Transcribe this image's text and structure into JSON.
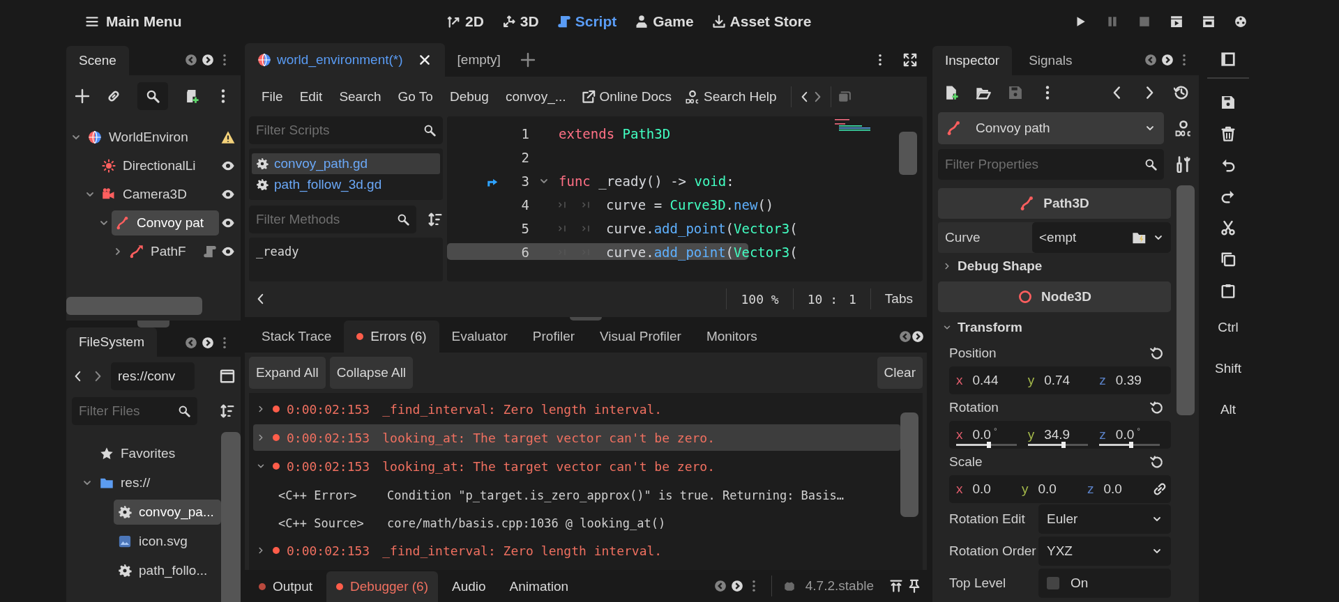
{
  "main_menu": "Main Menu",
  "workspaces": [
    {
      "label": "2D",
      "selected": false
    },
    {
      "label": "3D",
      "selected": false
    },
    {
      "label": "Script",
      "selected": true
    },
    {
      "label": "Game",
      "selected": false
    },
    {
      "label": "Asset Store",
      "selected": false
    }
  ],
  "scene_dock": {
    "tabs": [
      {
        "label": "Scene",
        "selected": true
      }
    ],
    "tree": [
      {
        "label": "WorldEnviron",
        "kind": "world_environment",
        "expanded": true,
        "selected": false,
        "warning": true,
        "children": [
          {
            "label": "DirectionalLi",
            "kind": "directional_light",
            "selected": false,
            "visible": true
          },
          {
            "label": "Camera3D",
            "kind": "camera",
            "expanded": true,
            "selected": false,
            "visible": true,
            "children": [
              {
                "label": "Convoy pat",
                "kind": "path",
                "expanded": true,
                "selected": true,
                "visible": true,
                "children": [
                  {
                    "label": "PathF",
                    "kind": "path_follow",
                    "expanded": false,
                    "selected": false,
                    "script": true,
                    "visible": true
                  }
                ]
              }
            ]
          }
        ]
      }
    ]
  },
  "filesystem_dock": {
    "tabs": [
      {
        "label": "FileSystem",
        "selected": true
      }
    ],
    "path": "res://conv",
    "filter_placeholder": "Filter Files",
    "tree": [
      {
        "label": "Favorites",
        "kind": "favorites",
        "selected": false
      },
      {
        "label": "res://",
        "kind": "folder",
        "expanded": true,
        "selected": false,
        "children": [
          {
            "label": "convoy_pa...",
            "kind": "script",
            "selected": true
          },
          {
            "label": "icon.svg",
            "kind": "image",
            "selected": false
          },
          {
            "label": "path_follo...",
            "kind": "script",
            "selected": false
          }
        ]
      }
    ]
  },
  "script_editor": {
    "tabs": [
      {
        "label": "world_environment(*)",
        "selected": true
      },
      {
        "label": "[empty]",
        "selected": false
      }
    ],
    "menu": [
      "File",
      "Edit",
      "Search",
      "Go To",
      "Debug",
      "convoy_..."
    ],
    "links": [
      "Online Docs",
      "Search Help"
    ],
    "filter_scripts_placeholder": "Filter Scripts",
    "scripts": [
      {
        "label": "convoy_path.gd",
        "selected": true
      },
      {
        "label": "path_follow_3d.gd",
        "selected": false
      }
    ],
    "filter_methods_placeholder": "Filter Methods",
    "methods": [
      "_ready"
    ],
    "lines": [
      {
        "number": "1",
        "tokens": [
          {
            "text": "extends",
            "kind": "keyword"
          },
          {
            "text": " Path3D",
            "kind": "type"
          }
        ]
      },
      {
        "number": "2"
      },
      {
        "number": "3",
        "signal": true,
        "fold": true,
        "tokens": [
          {
            "text": "func",
            "kind": "keyword"
          },
          {
            "text": " _ready() -> ",
            "kind": "plain"
          },
          {
            "text": "void",
            "kind": "type"
          },
          {
            "text": ":",
            "kind": "plain"
          }
        ]
      },
      {
        "number": "4",
        "indented": true,
        "tokens": [
          {
            "text": "curve = ",
            "kind": "plain"
          },
          {
            "text": "Curve3D",
            "kind": "type"
          },
          {
            "text": ".",
            "kind": "plain"
          },
          {
            "text": "new",
            "kind": "call"
          },
          {
            "text": "()",
            "kind": "plain"
          }
        ]
      },
      {
        "number": "5",
        "indented": true,
        "tokens": [
          {
            "text": "curve.",
            "kind": "plain"
          },
          {
            "text": "add_point",
            "kind": "call"
          },
          {
            "text": "(",
            "kind": "plain"
          },
          {
            "text": "Vector3",
            "kind": "type"
          },
          {
            "text": "(",
            "kind": "plain"
          }
        ]
      },
      {
        "number": "6",
        "indented": true,
        "tokens": [
          {
            "text": "curve.",
            "kind": "plain"
          },
          {
            "text": "add_point",
            "kind": "call"
          },
          {
            "text": "(",
            "kind": "plain"
          },
          {
            "text": "Vector3",
            "kind": "type"
          },
          {
            "text": "(",
            "kind": "plain"
          }
        ]
      }
    ],
    "zoom": "100 %",
    "line": "10 :",
    "column": "1",
    "indent_mode": "Tabs"
  },
  "debugger": {
    "tabs": [
      {
        "label": "Stack Trace",
        "selected": false,
        "alert": false
      },
      {
        "label": "Errors (6)",
        "selected": true,
        "alert": true
      },
      {
        "label": "Evaluator",
        "selected": false,
        "alert": false
      },
      {
        "label": "Profiler",
        "selected": false,
        "alert": false
      },
      {
        "label": "Visual Profiler",
        "selected": false,
        "alert": false
      },
      {
        "label": "Monitors",
        "selected": false,
        "alert": false
      }
    ],
    "buttons": [
      "Expand All",
      "Collapse All"
    ],
    "clear_button": "Clear",
    "errors": [
      {
        "time": "0:00:02:153",
        "message": "_find_interval: Zero length interval.",
        "expanded": false,
        "selected": false
      },
      {
        "time": "0:00:02:153",
        "message": "looking_at: The target vector can't be zero.",
        "expanded": false,
        "selected": true
      },
      {
        "time": "0:00:02:153",
        "message": "looking_at: The target vector can't be zero.",
        "expanded": true,
        "selected": false,
        "details": [
          {
            "label": "<C++ Error>",
            "text": "Condition \"p_target.is_zero_approx()\" is true. Returning: Basis…"
          },
          {
            "label": "<C++ Source>",
            "text": "core/math/basis.cpp:1036 @ looking_at()"
          }
        ]
      },
      {
        "time": "0:00:02:153",
        "message": "_find_interval: Zero length interval.",
        "expanded": false,
        "selected": false
      }
    ]
  },
  "bottom_panel": {
    "tabs": [
      {
        "label": "Output",
        "selected": false,
        "alert": true
      },
      {
        "label": "Debugger (6)",
        "selected": true,
        "alert": true
      },
      {
        "label": "Audio",
        "selected": false,
        "alert": false
      },
      {
        "label": "Animation",
        "selected": false,
        "alert": false
      }
    ],
    "version": "4.7.2.stable"
  },
  "inspector": {
    "tabs": [
      {
        "label": "Inspector",
        "selected": true
      },
      {
        "label": "Signals",
        "selected": false
      }
    ],
    "object": "Convoy path",
    "filter_placeholder": "Filter Properties",
    "items": [
      {
        "kind": "class_header",
        "label": "Path3D"
      },
      {
        "kind": "resource",
        "label": "Curve",
        "value": "<empt"
      },
      {
        "kind": "group",
        "label": "Debug Shape",
        "expanded": false
      },
      {
        "kind": "class_header",
        "label": "Node3D"
      },
      {
        "kind": "group",
        "label": "Transform",
        "expanded": true
      },
      {
        "kind": "vector",
        "label": "Position",
        "fields": [
          {
            "axis": "x",
            "value": "0.44"
          },
          {
            "axis": "y",
            "value": "0.74"
          },
          {
            "axis": "z",
            "value": "0.39"
          }
        ]
      },
      {
        "kind": "vector",
        "label": "Rotation",
        "fields": [
          {
            "axis": "x",
            "value": "0.0",
            "unit": "°",
            "level": 0.54
          },
          {
            "axis": "y",
            "value": "34.9",
            "level": 0.59
          },
          {
            "axis": "z",
            "value": "0.0",
            "unit": "°",
            "level": 0.53
          }
        ]
      },
      {
        "kind": "vector",
        "label": "Scale",
        "linked": true,
        "fields": [
          {
            "axis": "x",
            "value": "0.0"
          },
          {
            "axis": "y",
            "value": "0.0"
          },
          {
            "axis": "z",
            "value": "0.0"
          }
        ]
      },
      {
        "kind": "dropdown",
        "label": "Rotation Edit",
        "value": "Euler"
      },
      {
        "kind": "dropdown",
        "label": "Rotation Order",
        "value": "YXZ"
      },
      {
        "kind": "checkbox",
        "label": "Top Level",
        "checked": false,
        "text": "On"
      }
    ]
  },
  "shortcut_keys": [
    "Ctrl",
    "Shift",
    "Alt"
  ]
}
